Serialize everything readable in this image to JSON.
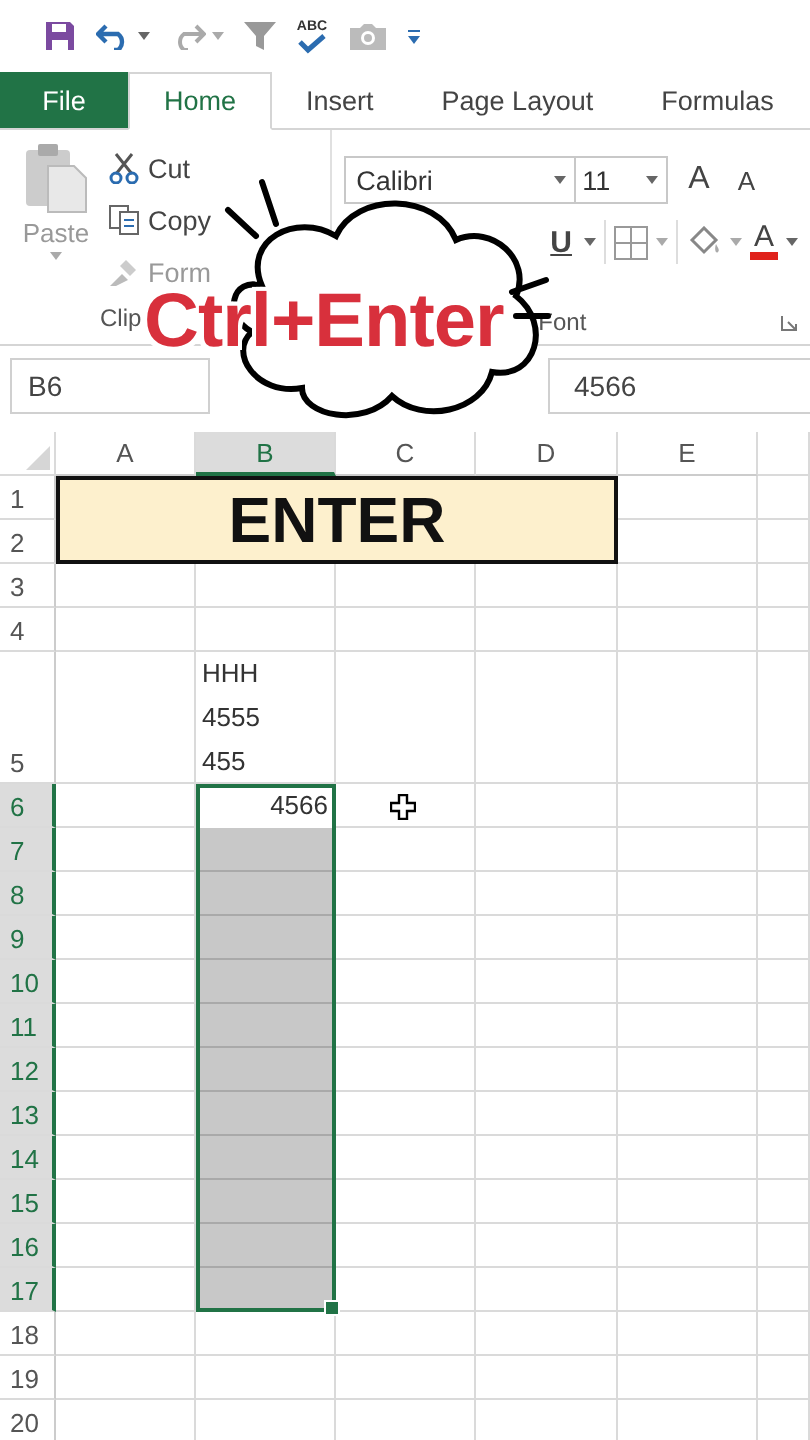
{
  "quick_access": {
    "spell_label": "ABC"
  },
  "tabs": [
    {
      "label": "File",
      "kind": "file",
      "selected": false
    },
    {
      "label": "Home",
      "kind": "tab",
      "selected": true
    },
    {
      "label": "Insert",
      "kind": "tab",
      "selected": false
    },
    {
      "label": "Page Layout",
      "kind": "tab",
      "selected": false
    },
    {
      "label": "Formulas",
      "kind": "tab",
      "selected": false
    }
  ],
  "clipboard_group": {
    "paste": "Paste",
    "cut": "Cut",
    "copy": "Copy",
    "format": "Form",
    "label": "Clip"
  },
  "font_group": {
    "font_name": "Calibri",
    "font_size": "11",
    "grow": "A",
    "shrink": "A",
    "underline": "U",
    "font_color": "A",
    "label": "Font"
  },
  "name_box": {
    "value": "B6"
  },
  "formula_bar": {
    "value": "4566"
  },
  "columns": [
    {
      "label": "A",
      "selected": false
    },
    {
      "label": "B",
      "selected": true
    },
    {
      "label": "C",
      "selected": false
    },
    {
      "label": "D",
      "selected": false
    },
    {
      "label": "E",
      "selected": false
    }
  ],
  "rows": [
    {
      "label": "1",
      "selected": false,
      "cells": [
        {
          "kind": "banner",
          "text": "ENTER"
        }
      ]
    },
    {
      "label": "2",
      "selected": false
    },
    {
      "label": "3",
      "selected": false
    },
    {
      "label": "4",
      "selected": false
    },
    {
      "label": "5",
      "selected": false,
      "cells": [
        {
          "kind": "empty"
        },
        {
          "kind": "text",
          "text": "HHH\n4555\n455"
        }
      ]
    },
    {
      "label": "6",
      "selected": true,
      "cells": [
        {
          "kind": "empty"
        },
        {
          "kind": "number",
          "text": "4566",
          "active": true
        }
      ]
    },
    {
      "label": "7",
      "selected": true
    },
    {
      "label": "8",
      "selected": true
    },
    {
      "label": "9",
      "selected": true
    },
    {
      "label": "10",
      "selected": true
    },
    {
      "label": "11",
      "selected": true
    },
    {
      "label": "12",
      "selected": true
    },
    {
      "label": "13",
      "selected": true
    },
    {
      "label": "14",
      "selected": true
    },
    {
      "label": "15",
      "selected": true
    },
    {
      "label": "16",
      "selected": true
    },
    {
      "label": "17",
      "selected": true
    },
    {
      "label": "18",
      "selected": false
    },
    {
      "label": "19",
      "selected": false
    },
    {
      "label": "20",
      "selected": false
    }
  ],
  "overlay": {
    "caption": "Ctrl+Enter"
  }
}
